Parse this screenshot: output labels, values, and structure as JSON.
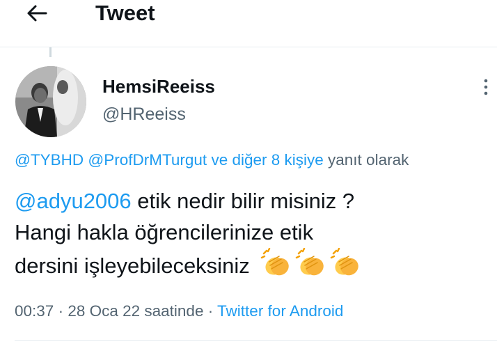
{
  "header": {
    "title": "Tweet",
    "back_icon": "arrow-left-icon"
  },
  "author": {
    "display_name": "HemsiReeiss",
    "handle": "@HReeiss"
  },
  "reply_context": {
    "mention_1": "@TYBHD",
    "mention_2": "@ProfDrMTurgut",
    "others": "ve diğer 8 kişiye",
    "suffix": "yanıt olarak"
  },
  "tweet": {
    "mention": "@adyu2006",
    "line_1": "etik nedir bilir misiniz ?",
    "line_2": "Hangi hakla öğrencilerinize etik",
    "line_3": "dersini işleyebileceksiniz",
    "emojis": [
      "clapping-hands-icon",
      "clapping-hands-icon",
      "clapping-hands-icon"
    ]
  },
  "meta": {
    "time": "00:37",
    "separator_1": " · ",
    "date": "28 Oca 22 saatinde",
    "separator_2": " · ",
    "source": "Twitter for Android"
  },
  "colors": {
    "link": "#1d9bf0",
    "text": "#0f1419",
    "secondary": "#536471"
  }
}
